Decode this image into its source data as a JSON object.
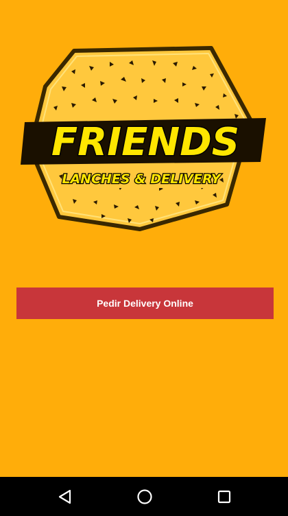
{
  "colors": {
    "background": "#FFAD0A",
    "button": "#C8363A",
    "button_text": "#FFFFFF",
    "nav_bar": "#000000"
  },
  "logo": {
    "brand": "FRIENDS",
    "tagline": "LANCHES & DELIVERY",
    "icon": "friends-hexagon-logo"
  },
  "main": {
    "cta_label": "Pedir Delivery Online"
  },
  "nav_bar": {
    "back_icon": "back-triangle-icon",
    "home_icon": "home-circle-icon",
    "recents_icon": "recents-square-icon"
  }
}
